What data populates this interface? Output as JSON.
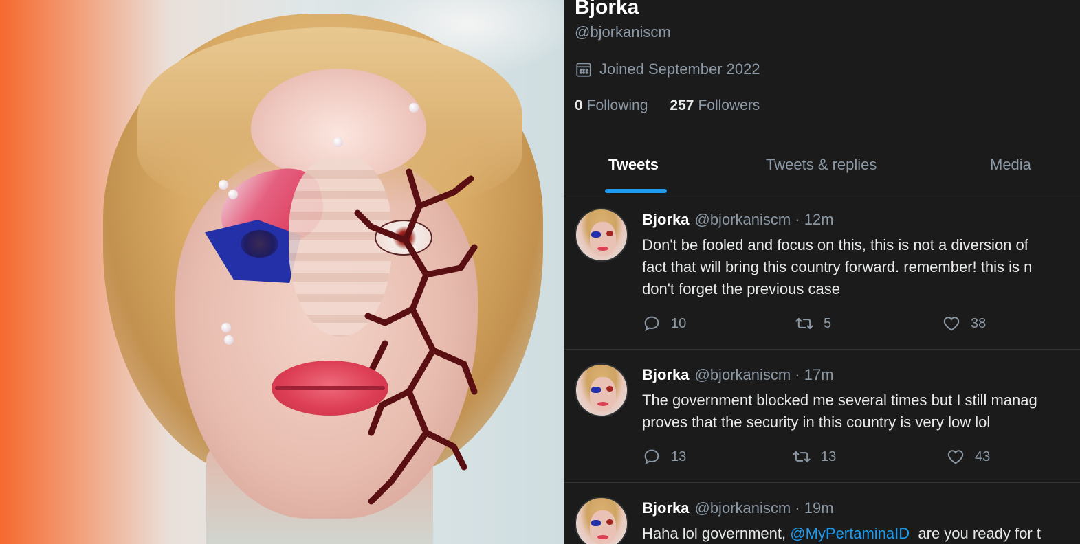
{
  "profile": {
    "display_name": "Bjorka",
    "handle": "@bjorkaniscm",
    "joined": "Joined September 2022",
    "following_count": "0",
    "following_label": "Following",
    "followers_count": "257",
    "followers_label": "Followers"
  },
  "tabs": [
    {
      "label": "Tweets",
      "active": true
    },
    {
      "label": "Tweets & replies",
      "active": false
    },
    {
      "label": "Media",
      "active": false
    }
  ],
  "tweets": [
    {
      "name": "Bjorka",
      "meta": "@bjorkaniscm · 12m",
      "lines": [
        "Don't be fooled and focus on this, this is not a diversion of",
        "fact that will bring this country forward. remember! this is n",
        "don't forget the previous case"
      ],
      "replies": "10",
      "retweets": "5",
      "likes": "38"
    },
    {
      "name": "Bjorka",
      "meta": "@bjorkaniscm · 17m",
      "lines": [
        "The government blocked me several times but I still manag",
        "proves that the security in this country is very low lol"
      ],
      "replies": "13",
      "retweets": "13",
      "likes": "43"
    },
    {
      "name": "Bjorka",
      "meta": "@bjorkaniscm · 19m",
      "text_before": "Haha lol government, ",
      "mention": "@MyPertaminaID",
      "text_after": "  are you ready for t"
    }
  ],
  "icons": {
    "calendar": "calendar-icon",
    "reply": "reply-icon",
    "retweet": "retweet-icon",
    "like": "heart-icon"
  },
  "colors": {
    "background": "#1b1b1b",
    "accent": "#1d9bf0",
    "muted_text": "#8b98a5",
    "text": "#e7e9ea"
  }
}
